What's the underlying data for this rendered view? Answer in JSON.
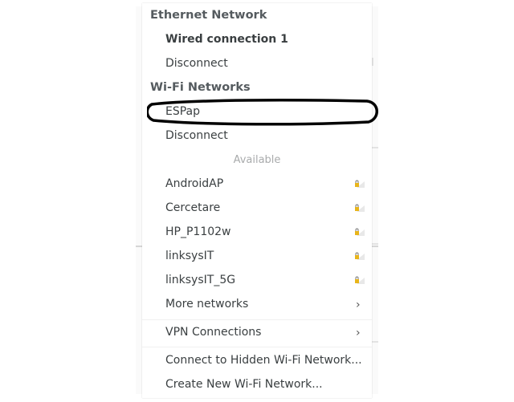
{
  "ethernet": {
    "header": "Ethernet Network",
    "connection": "Wired connection 1",
    "disconnect": "Disconnect"
  },
  "wifi": {
    "header": "Wi-Fi Networks",
    "connected": "ESPap",
    "disconnect": "Disconnect",
    "available_label": "Available",
    "networks": [
      {
        "name": "AndroidAP",
        "icon": "wifi-locked-icon"
      },
      {
        "name": "Cercetare",
        "icon": "wifi-locked-icon"
      },
      {
        "name": "HP_P1102w",
        "icon": "wifi-locked-icon"
      },
      {
        "name": "linksysIT",
        "icon": "wifi-locked-icon"
      },
      {
        "name": "linksysIT_5G",
        "icon": "wifi-locked-icon"
      }
    ],
    "more": "More networks"
  },
  "vpn": {
    "label": "VPN Connections"
  },
  "actions": {
    "hidden": "Connect to Hidden Wi-Fi Network...",
    "create": "Create New Wi-Fi Network..."
  },
  "colors": {
    "lock": "#e8b51b",
    "annotation": "#000000"
  }
}
